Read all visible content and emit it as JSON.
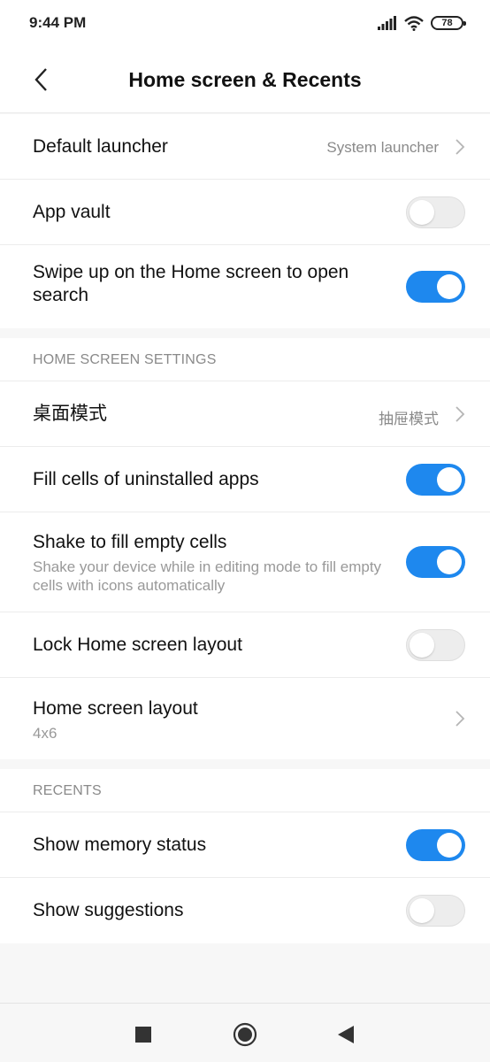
{
  "status_bar": {
    "time": "9:44 PM",
    "battery": "78"
  },
  "header": {
    "title": "Home screen & Recents"
  },
  "section1": {
    "rows": [
      {
        "title": "Default launcher",
        "value": "System launcher"
      },
      {
        "title": "App vault",
        "toggle": false
      },
      {
        "title": "Swipe up on the Home screen to open search",
        "toggle": true
      }
    ]
  },
  "home_screen_settings": {
    "header": "HOME SCREEN SETTINGS",
    "rows": [
      {
        "title": "桌面模式",
        "value": "抽屉模式"
      },
      {
        "title": "Fill cells of uninstalled apps",
        "toggle": true
      },
      {
        "title": "Shake to fill empty cells",
        "subtitle": "Shake your device while in editing mode to fill empty cells with icons automatically",
        "toggle": true
      },
      {
        "title": "Lock Home screen layout",
        "toggle": false
      },
      {
        "title": "Home screen layout",
        "subtitle": "4x6"
      }
    ]
  },
  "recents": {
    "header": "RECENTS",
    "rows": [
      {
        "title": "Show memory status",
        "toggle": true
      },
      {
        "title": "Show suggestions",
        "toggle": false
      }
    ]
  },
  "colors": {
    "accent": "#1e88ee",
    "background": "#f7f7f7"
  },
  "icons": {
    "back": "back-chevron-icon",
    "chevron": "chevron-right-icon",
    "nav_recents": "square-icon",
    "nav_home": "circle-icon",
    "nav_back": "triangle-back-icon"
  }
}
